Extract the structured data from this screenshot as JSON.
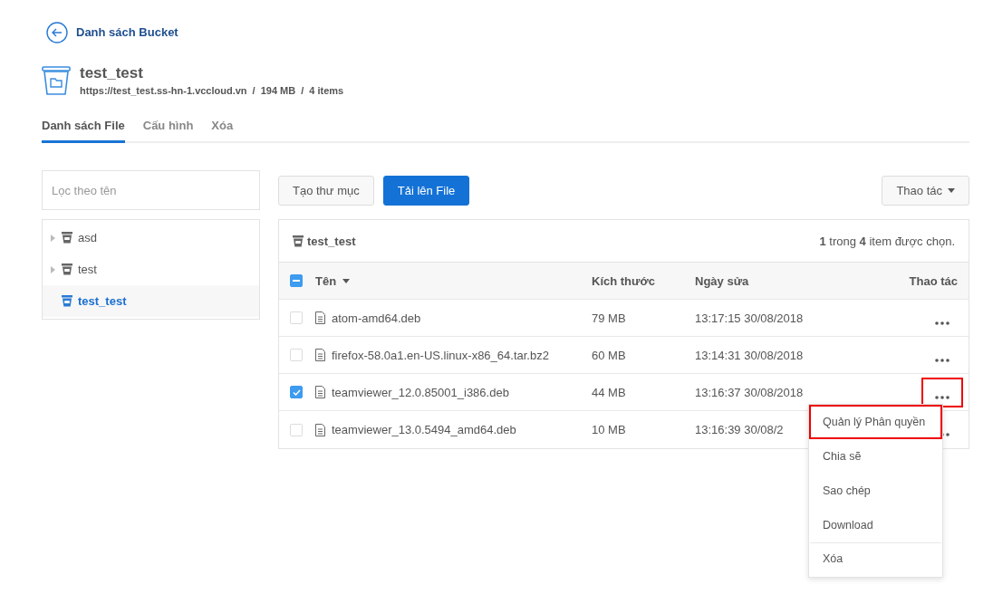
{
  "back_link": {
    "label": "Danh sách Bucket"
  },
  "bucket": {
    "name": "test_test",
    "url": "https://test_test.ss-hn-1.vccloud.vn",
    "size": "194 MB",
    "count": "4 items",
    "separator": "/"
  },
  "tabs": [
    {
      "label": "Danh sách File",
      "selected": true
    },
    {
      "label": "Cấu hình",
      "selected": false
    },
    {
      "label": "Xóa",
      "selected": false
    }
  ],
  "filter": {
    "placeholder": "Lọc theo tên"
  },
  "tree": [
    {
      "label": "asd",
      "expandable": true,
      "selected": false
    },
    {
      "label": "test",
      "expandable": true,
      "selected": false
    },
    {
      "label": "test_test",
      "expandable": false,
      "selected": true
    }
  ],
  "toolbar": {
    "buttons": [
      {
        "label": "Tạo thư mục",
        "kind": "default"
      },
      {
        "label": "Tải lên File",
        "kind": "primary"
      }
    ],
    "actions": "Thao tác"
  },
  "table": {
    "title": "test_test",
    "selection": "**1** trong **4** item được chọn.",
    "select_all": {
      "indeterminate": true
    },
    "columns": [
      "Tên",
      "Kích thước",
      "Ngày sửa",
      "Thao tác"
    ],
    "rows": [
      {
        "name": "atom-amd64.deb",
        "size": "79 MB",
        "date": "13:17:15 30/08/2018",
        "selected": false,
        "highlighted": false
      },
      {
        "name": "firefox-58.0a1.en-US.linux-x86_64.tar.bz2",
        "size": "60 MB",
        "date": "13:14:31 30/08/2018",
        "selected": false,
        "highlighted": false
      },
      {
        "name": "teamviewer_12.0.85001_i386.deb",
        "size": "44 MB",
        "date": "13:16:37 30/08/2018",
        "selected": true,
        "highlighted": true
      },
      {
        "name": "teamviewer_13.0.5494_amd64.deb",
        "size": "10 MB",
        "date": "13:16:39 30/08/2",
        "selected": false,
        "highlighted": false
      }
    ]
  },
  "menu": {
    "items": [
      {
        "label": "Quản lý Phân quyền",
        "highlighted": true,
        "divider": false
      },
      {
        "label": "Chia sẽ",
        "highlighted": false,
        "divider": false
      },
      {
        "label": "Sao chép",
        "highlighted": false,
        "divider": false
      },
      {
        "label": "Download",
        "highlighted": false,
        "divider": false
      },
      {
        "label": "Xóa",
        "highlighted": false,
        "divider": true
      }
    ]
  }
}
